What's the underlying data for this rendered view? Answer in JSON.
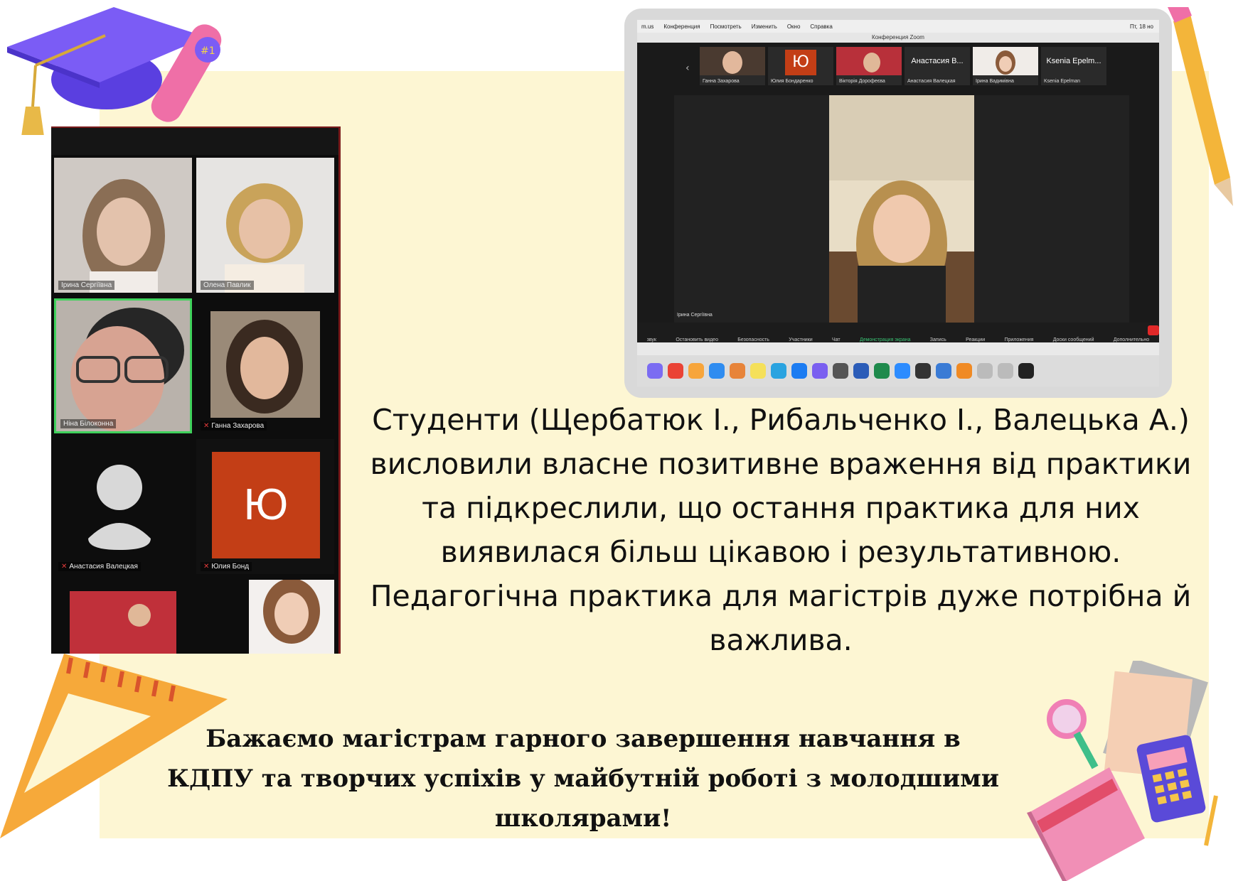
{
  "gallery": {
    "tiles": [
      {
        "name": "Ірина Сергіївна",
        "muted": false
      },
      {
        "name": "Олена Павлик",
        "muted": false
      },
      {
        "name": "Ніна Білоконна",
        "muted": false
      },
      {
        "name": "Ганна Захарова",
        "muted": true
      },
      {
        "name": "Анастасия Валецкая",
        "muted": true
      },
      {
        "name": "Юлия Бонд",
        "muted": true,
        "initial": "Ю"
      }
    ]
  },
  "zoom": {
    "menu": [
      "m.us",
      "Конференция",
      "Посмотреть",
      "Изменить",
      "Окно",
      "Справка"
    ],
    "clock": "Пт, 18 но",
    "window_title": "Конференция Zoom",
    "thumbs": [
      {
        "label": "Ганна Захарова"
      },
      {
        "label": "Юлия Бондаренко",
        "initial": "Ю"
      },
      {
        "label": "Вікторія Дорофеєва"
      },
      {
        "label": "Анастасия Валецкая",
        "big": "Анастасия В..."
      },
      {
        "label": "Ірина Вадимівна"
      },
      {
        "label": "Ksenia Epelman",
        "big": "Ksenia Epelm..."
      }
    ],
    "speaker_label": "Ірина Сергіївна",
    "toolbar": [
      "звук",
      "Остановить видео",
      "Безопасность",
      "Участники",
      "Чат",
      "Демонстрация экрана",
      "Запись",
      "Реакции",
      "Приложения",
      "Доски сообщений",
      "Дополнительно"
    ]
  },
  "text": {
    "main": "Студенти (Щербатюк І., Рибальченко І., Валецька А.) висловили власне позитивне враження від практики та підкреслили, що остання практика для них виявилася більш цікавою і результативною. Педагогічна практика для магістрів дуже потрібна й важлива.",
    "wish": "Бажаємо магістрам гарного завершення навчання в КДПУ та творчих успіхів у майбутній роботі з молодшими школярами!"
  },
  "colors": {
    "background": "#fdf6d3",
    "zoom_avatar": "#c33e16",
    "active_speaker_border": "#3fd15b"
  }
}
